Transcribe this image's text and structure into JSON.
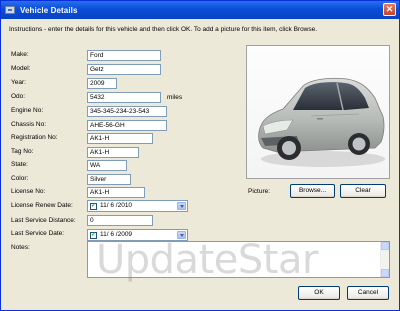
{
  "window": {
    "title": "Vehicle Details",
    "close_glyph": "✕"
  },
  "instructions": "Instructions - enter the details for this vehicle and then click OK. To add a picture for this item, click Browse.",
  "fields": {
    "make": {
      "label": "Make:",
      "value": "Ford"
    },
    "model": {
      "label": "Model:",
      "value": "Getz"
    },
    "year": {
      "label": "Year:",
      "value": "2009"
    },
    "odo": {
      "label": "Odo:",
      "value": "5432",
      "unit": "miles"
    },
    "engine_no": {
      "label": "Engine No:",
      "value": "345-345-234-23-543"
    },
    "chassis_no": {
      "label": "Chassis No:",
      "value": "AHE-56-GH"
    },
    "registration_no": {
      "label": "Registration No:",
      "value": "AK1-H"
    },
    "tag_no": {
      "label": "Tag No:",
      "value": "AK1-H"
    },
    "state": {
      "label": "State:",
      "value": "WA"
    },
    "color": {
      "label": "Color:",
      "value": "Silver"
    },
    "license_no": {
      "label": "License No:",
      "value": "AK1-H"
    },
    "license_renew_date": {
      "label": "License Renew Date:",
      "value": "11/ 6 /2010",
      "checked": true
    },
    "last_service_distance": {
      "label": "Last Service Distance:",
      "value": "0"
    },
    "last_service_date": {
      "label": "Last Service Date:",
      "value": "11/ 6 /2009",
      "checked": true
    },
    "notes": {
      "label": "Notes:",
      "value": ""
    }
  },
  "picture": {
    "label": "Picture:",
    "browse_label": "Browse...",
    "clear_label": "Clear"
  },
  "buttons": {
    "ok_label": "OK",
    "cancel_label": "Cancel"
  },
  "watermark": "UpdateStar",
  "colors": {
    "titlebar": "#0a4ed8",
    "dialog_bg": "#ece9d8",
    "car_body": "#b8bcb8"
  },
  "icons": {
    "title": "car-window-icon",
    "close": "close-icon",
    "checkbox": "checkmark-icon",
    "dropdown": "chevron-down-icon"
  }
}
